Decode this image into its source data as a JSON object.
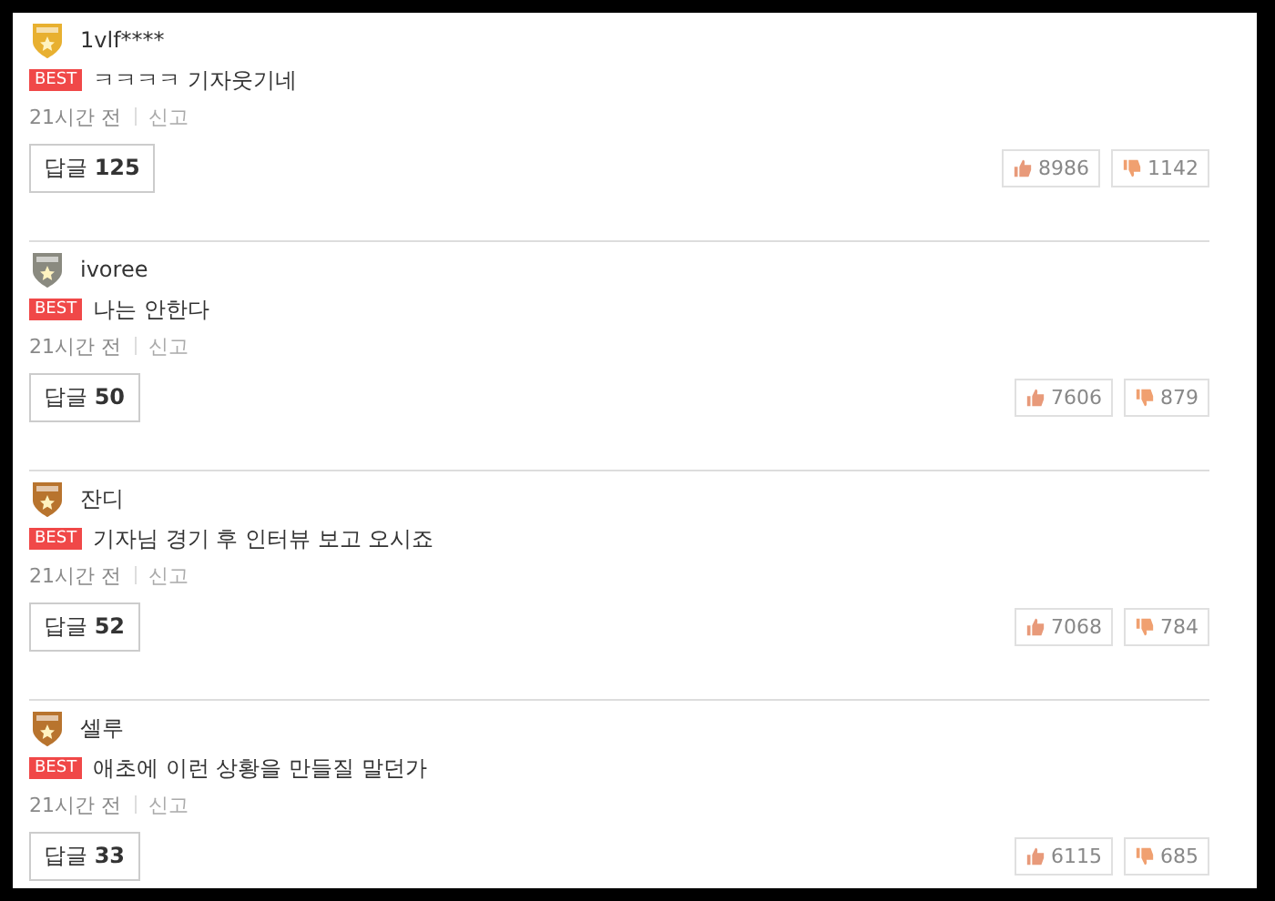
{
  "comments": [
    {
      "user": "1vlf****",
      "color": "#e8b030",
      "badge": "BEST",
      "text": "ㅋㅋㅋㅋ 기자웃기네",
      "time": "21시간 전",
      "report": "신고",
      "reply_label": "답글",
      "reply_count": "125",
      "likes": "8986",
      "dislikes": "1142"
    },
    {
      "user": "ivoree",
      "color": "#8a8a80",
      "badge": "BEST",
      "text": "나는 안한다",
      "time": "21시간 전",
      "report": "신고",
      "reply_label": "답글",
      "reply_count": "50",
      "likes": "7606",
      "dislikes": "879"
    },
    {
      "user": "잔디",
      "color": "#b8742e",
      "badge": "BEST",
      "text": "기자님 경기 후 인터뷰 보고 오시죠",
      "time": "21시간 전",
      "report": "신고",
      "reply_label": "답글",
      "reply_count": "52",
      "likes": "7068",
      "dislikes": "784"
    },
    {
      "user": "셀루",
      "color": "#b8742e",
      "badge": "BEST",
      "text": "애초에 이런 상황을 만들질 말던가",
      "time": "21시간 전",
      "report": "신고",
      "reply_label": "답글",
      "reply_count": "33",
      "likes": "6115",
      "dislikes": "685"
    }
  ]
}
